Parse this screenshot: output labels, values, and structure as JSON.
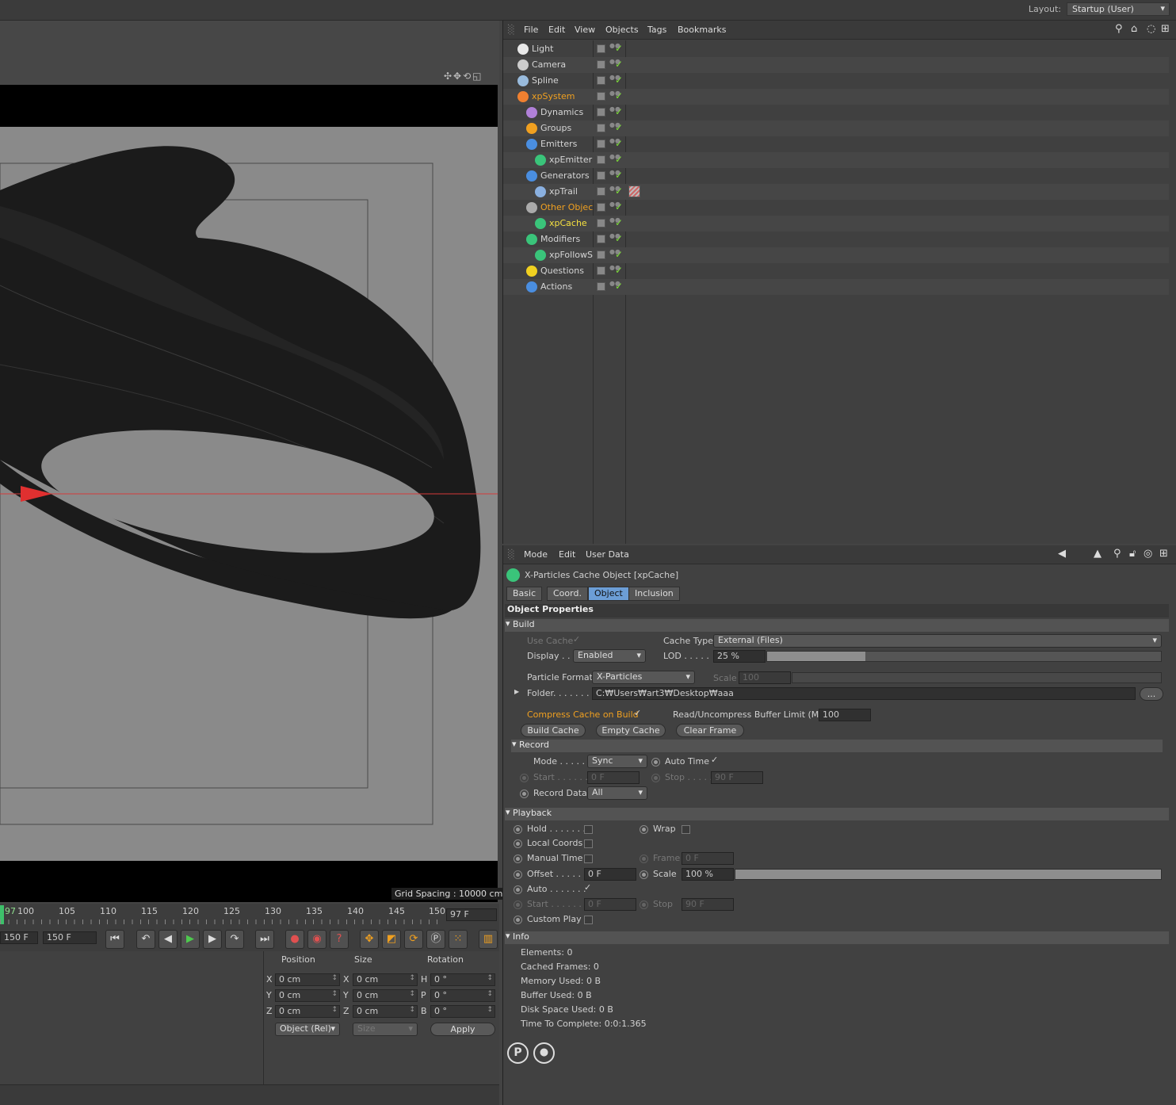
{
  "top": {
    "layout_label": "Layout:",
    "layout_value": "Startup (User)"
  },
  "viewport": {
    "grid_spacing": "Grid Spacing : 10000 cm"
  },
  "timeline": {
    "ticks": [
      "97",
      "100",
      "105",
      "110",
      "115",
      "120",
      "125",
      "130",
      "135",
      "140",
      "145",
      "150"
    ],
    "current_frame": "97 F"
  },
  "transport": {
    "start_field": "150 F",
    "end_field": "150 F"
  },
  "coords": {
    "position": "Position",
    "size": "Size",
    "rotation": "Rotation",
    "axes": [
      "X",
      "Y",
      "Z"
    ],
    "size_axes": [
      "X",
      "Y",
      "Z"
    ],
    "rot_axes": [
      "H",
      "P",
      "B"
    ],
    "pos_vals": [
      "0 cm",
      "0 cm",
      "0 cm"
    ],
    "size_vals": [
      "0 cm",
      "0 cm",
      "0 cm"
    ],
    "rot_vals": [
      "0 °",
      "0 °",
      "0 °"
    ],
    "mode": "Object (Rel)",
    "size_mode": "Size",
    "apply": "Apply"
  },
  "obj_menu": [
    "File",
    "Edit",
    "View",
    "Objects",
    "Tags",
    "Bookmarks"
  ],
  "tree": [
    {
      "name": "Light",
      "depth": 0
    },
    {
      "name": "Camera",
      "depth": 0
    },
    {
      "name": "Spline",
      "depth": 0
    },
    {
      "name": "xpSystem",
      "depth": 0,
      "orange": true
    },
    {
      "name": "Dynamics",
      "depth": 1
    },
    {
      "name": "Groups",
      "depth": 1
    },
    {
      "name": "Emitters",
      "depth": 1
    },
    {
      "name": "xpEmitter",
      "depth": 2
    },
    {
      "name": "Generators",
      "depth": 1
    },
    {
      "name": "xpTrail",
      "depth": 2
    },
    {
      "name": "Other Objects",
      "depth": 1,
      "orange": true
    },
    {
      "name": "xpCache",
      "depth": 2,
      "yellow": true
    },
    {
      "name": "Modifiers",
      "depth": 1
    },
    {
      "name": "xpFollowSpline",
      "depth": 2
    },
    {
      "name": "Questions",
      "depth": 1
    },
    {
      "name": "Actions",
      "depth": 1
    }
  ],
  "attr_menu": [
    "Mode",
    "Edit",
    "User Data"
  ],
  "attr": {
    "title": "X-Particles Cache Object [xpCache]",
    "tabs": [
      "Basic",
      "Coord.",
      "Object",
      "Inclusion"
    ],
    "object_props": "Object Properties",
    "build": "Build",
    "use_cache": "Use Cache",
    "cache_type": "Cache Type",
    "cache_type_val": "External (Files)",
    "display": "Display . . .",
    "display_val": "Enabled",
    "lod": "LOD . . . . .",
    "lod_val": "25 %",
    "particle_format": "Particle Format",
    "particle_format_val": "X-Particles",
    "scale": "Scale",
    "scale_val": "100",
    "folder": "Folder. . . . . . . . .",
    "folder_val": "C:₩Users₩art3₩Desktop₩aaa",
    "folder_btn": "...",
    "compress": "Compress Cache on Build",
    "buffer": "Read/Uncompress Buffer Limit (MB)",
    "buffer_val": "100",
    "build_cache": "Build Cache",
    "empty_cache": "Empty Cache",
    "clear_frame": "Clear Frame",
    "record": "Record",
    "mode": "Mode . . . . .",
    "mode_val": "Sync",
    "auto_time": "Auto Time",
    "start": "Start . . . . . .",
    "start_val": "0 F",
    "stop": "Stop . . . . .",
    "stop_val": "90 F",
    "record_data": "Record Data",
    "record_data_val": "All",
    "playback": "Playback",
    "hold": "Hold . . . . . . .",
    "wrap": "Wrap",
    "local_coords": "Local Coords",
    "manual_time": "Manual Time",
    "frame": "Frame",
    "frame_val": "0 F",
    "offset": "Offset . . . . . .",
    "offset_val": "0 F",
    "scale2": "Scale",
    "scale2_val": "100 %",
    "auto": "Auto . . . . . . .",
    "start2": "Start . . . . . . .",
    "start2_val": "0 F",
    "stop2": "Stop",
    "stop2_val": "90 F",
    "custom_play": "Custom Play",
    "info": "Info",
    "info_lines": [
      "Elements: 0",
      "Cached Frames: 0",
      "Memory Used: 0 B",
      "Buffer Used: 0 B",
      "Disk Space Used: 0 B",
      "Time To Complete: 0:0:1.365"
    ]
  },
  "colors": {
    "accent": "#6c9ed6",
    "orange": "#f0a020",
    "green": "#7ddc3a"
  }
}
